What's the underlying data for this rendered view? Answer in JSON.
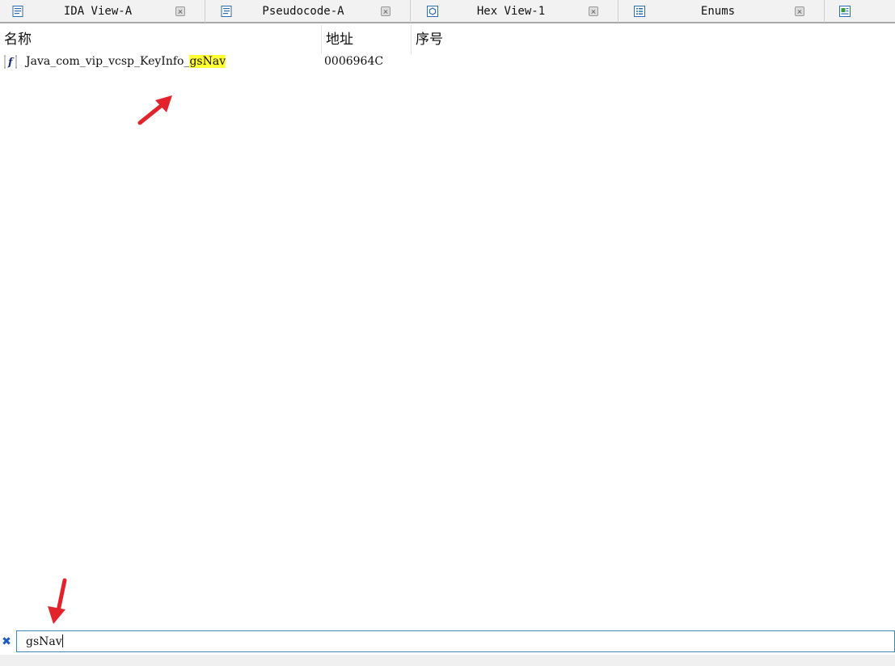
{
  "tabs": [
    {
      "label": "IDA View-A",
      "icon": "ida-view-icon"
    },
    {
      "label": "Pseudocode-A",
      "icon": "pseudocode-icon"
    },
    {
      "label": "Hex View-1",
      "icon": "hex-view-icon"
    },
    {
      "label": "Enums",
      "icon": "enums-icon"
    },
    {
      "label": "",
      "icon": "imports-icon"
    }
  ],
  "columns": {
    "name": "名称",
    "address": "地址",
    "ordinal": "序号"
  },
  "rows": [
    {
      "name_prefix": "Java_com_vip_vcsp_KeyInfo_",
      "name_match": "gsNav",
      "address": "0006964C",
      "ordinal": "",
      "icon": "function-icon"
    }
  ],
  "filter": {
    "value": "gsNav",
    "clear_icon": "clear-filter-icon"
  },
  "colors": {
    "highlight": "#ffff33",
    "annotation_arrow": "#e3232b",
    "input_border": "#3c89b8"
  }
}
